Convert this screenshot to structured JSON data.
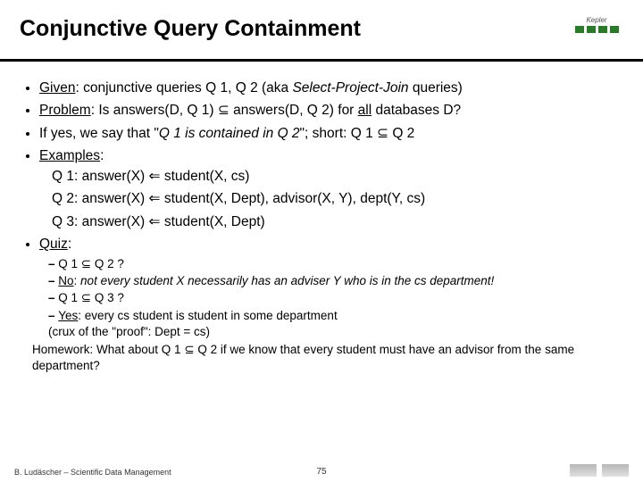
{
  "header": {
    "title": "Conjunctive Query Containment",
    "logo_label": "Kepler"
  },
  "bullets": {
    "given_label": "Given",
    "given_rest": ": conjunctive queries Q 1, Q 2 (aka ",
    "given_em": "Select-Project-Join",
    "given_tail": " queries)",
    "problem_label": "Problem",
    "problem_rest": ": Is answers(D, Q 1) ⊆ answers(D, Q 2) for ",
    "problem_all": "all",
    "problem_tail": " databases D?",
    "ifyes_pre": "If yes, we say that \"",
    "ifyes_em": "Q 1 is contained in Q 2",
    "ifyes_post": "\"; short: Q 1 ⊆ Q 2",
    "examples_label": "Examples",
    "examples_colon": ":",
    "q1": "Q 1: answer(X) ⇐ student(X, cs)",
    "q2": "Q 2: answer(X) ⇐ student(X, Dept), advisor(X, Y), dept(Y, cs)",
    "q3": "Q 3: answer(X) ⇐ student(X, Dept)",
    "quiz_label": "Quiz",
    "quiz_colon": ":"
  },
  "quiz": {
    "d1": "Q 1 ⊆ Q 2 ?",
    "d2_no": "No",
    "d2_rest": ": ",
    "d2_em": "not every student X necessarily has an adviser Y who is in the cs department!",
    "d3": "Q 1 ⊆ Q 3 ?",
    "d4_yes": "Yes",
    "d4_rest": ": every cs student is student in some department",
    "d4_crux": "(crux of the \"proof\": Dept = cs)",
    "homework": "Homework: What about Q 1 ⊆ Q 2 if we know that every student must have an advisor from the same department?"
  },
  "footer": {
    "left": "B. Ludäscher – Scientific Data Management",
    "page": "75"
  }
}
